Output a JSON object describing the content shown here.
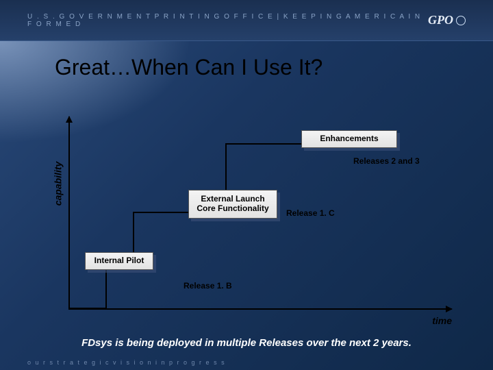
{
  "header": {
    "org_text": "U . S .   G O V E R N M E N T   P R I N T I N G   O F F I C E   |   K E E P I N G   A M E R I C A   I N F O R M E D",
    "logo_text": "GPO"
  },
  "title": "Great…When Can I Use It?",
  "chart_data": {
    "type": "step",
    "xlabel": "time",
    "ylabel": "capability",
    "stages": [
      {
        "title": "Internal Pilot",
        "release": "Release 1. B"
      },
      {
        "title": "External Launch Core Functionality",
        "release": "Release 1. C"
      },
      {
        "title": "Enhancements",
        "release": "Releases 2 and 3"
      }
    ]
  },
  "caption": "FDsys is being deployed in multiple Releases over the next 2 years.",
  "footer": "o u r   s t r a t e g i c   v i s i o n   i n   p r o g r e s s"
}
